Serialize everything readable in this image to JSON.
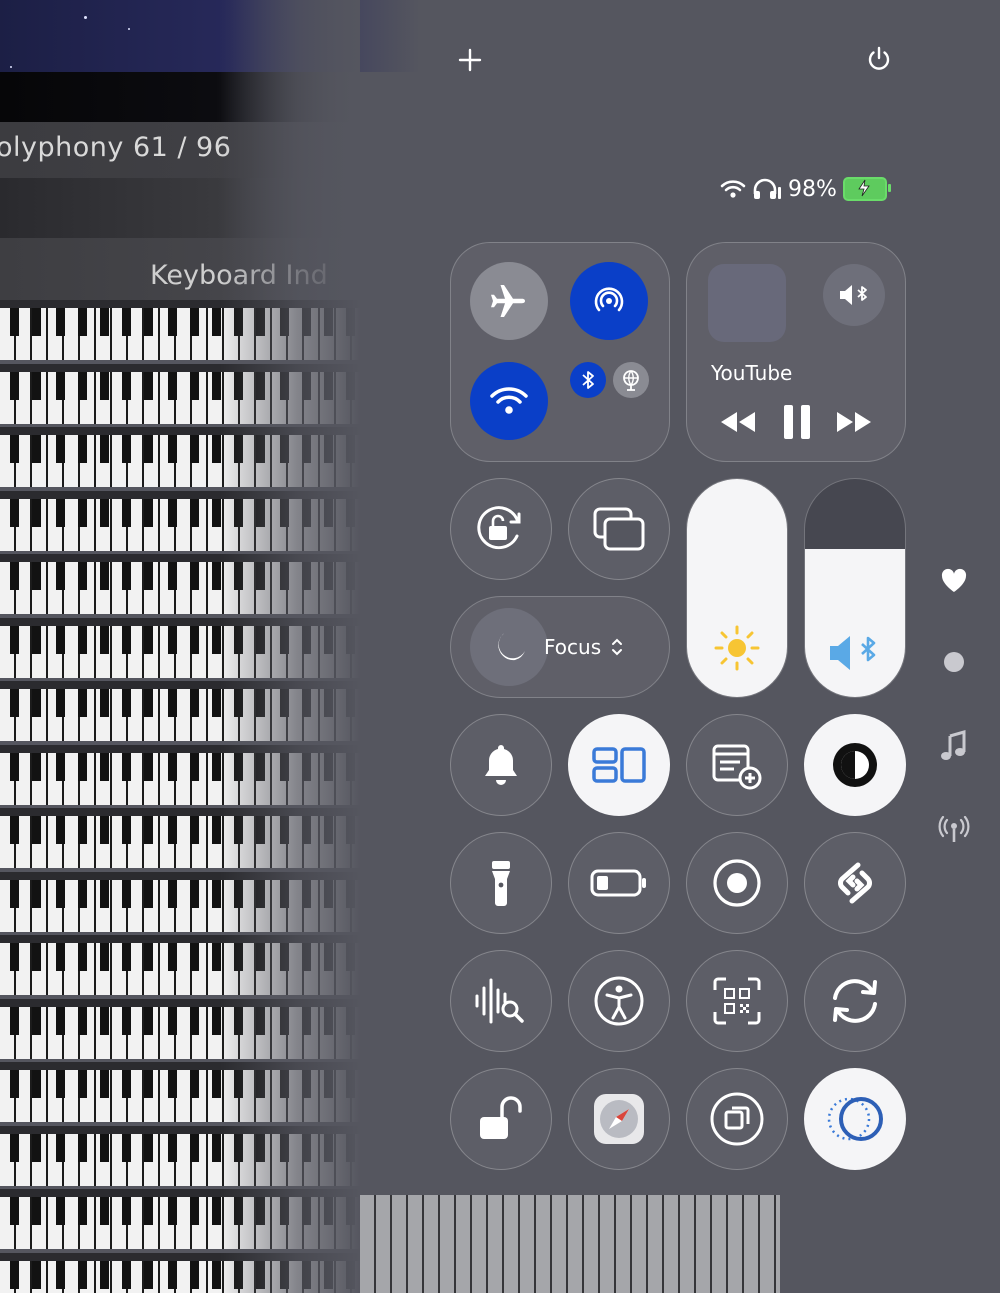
{
  "background_app": {
    "polyphony_text": "olyphony 61 / 96",
    "keyboard_header": "Keyboard Ind"
  },
  "top_bar": {
    "add_icon": "plus-icon",
    "power_icon": "power-icon"
  },
  "status_bar": {
    "battery_percent": "98%",
    "battery_level": 0.98,
    "charging": true,
    "icons": [
      "wifi-icon",
      "headphones-icon",
      "battery-icon"
    ]
  },
  "connectivity": {
    "airplane_mode": false,
    "airdrop": true,
    "wifi": true,
    "bluetooth": true,
    "accent_color": "#0a3fc8"
  },
  "now_playing": {
    "app": "YouTube",
    "output_icon": "speaker-bluetooth-icon",
    "controls": [
      "rewind-icon",
      "pause-icon",
      "fast-forward-icon"
    ]
  },
  "focus": {
    "label": "Focus",
    "icon": "moon-icon"
  },
  "brightness": {
    "level": 1.0,
    "icon": "sun-icon"
  },
  "volume": {
    "level": 0.68,
    "icon": "speaker-bluetooth-icon"
  },
  "tiles": [
    "orientation-lock-icon",
    "screen-mirroring-icon",
    "bell-icon",
    "stage-manager-icon",
    "quick-note-icon",
    "dark-mode-icon",
    "flashlight-icon",
    "low-power-icon",
    "screen-record-icon",
    "shazam-icon",
    "sound-recognition-icon",
    "accessibility-icon",
    "qr-code-scanner-icon",
    "sync-icon",
    "unlock-icon",
    "safari-icon",
    "guided-access-icon",
    "live-activity-icon"
  ],
  "sidebar": [
    "heart-icon",
    "dot-icon",
    "music-note-icon",
    "antenna-icon"
  ]
}
